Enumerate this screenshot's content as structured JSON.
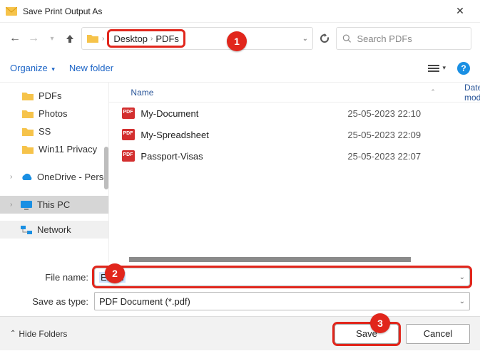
{
  "title": "Save Print Output As",
  "breadcrumb": {
    "parts": [
      "Desktop",
      "PDFs"
    ]
  },
  "search": {
    "placeholder": "Search PDFs"
  },
  "toolbar": {
    "organize": "Organize",
    "new_folder": "New folder"
  },
  "columns": {
    "name": "Name",
    "date": "Date modified"
  },
  "files": [
    {
      "name": "My-Document",
      "date": "25-05-2023 22:10"
    },
    {
      "name": "My-Spreadsheet",
      "date": "25-05-2023 22:09"
    },
    {
      "name": "Passport-Visas",
      "date": "25-05-2023 22:07"
    }
  ],
  "sidebar": {
    "folders": [
      "PDFs",
      "Photos",
      "SS",
      "Win11 Privacy"
    ],
    "onedrive": "OneDrive - Perso",
    "thispc": "This PC",
    "network": "Network"
  },
  "form": {
    "filename_label": "File name:",
    "filename_value": "Email",
    "type_label": "Save as type:",
    "type_value": "PDF Document (*.pdf)"
  },
  "footer": {
    "hide": "Hide Folders",
    "save": "Save",
    "cancel": "Cancel"
  },
  "callouts": {
    "c1": "1",
    "c2": "2",
    "c3": "3"
  }
}
